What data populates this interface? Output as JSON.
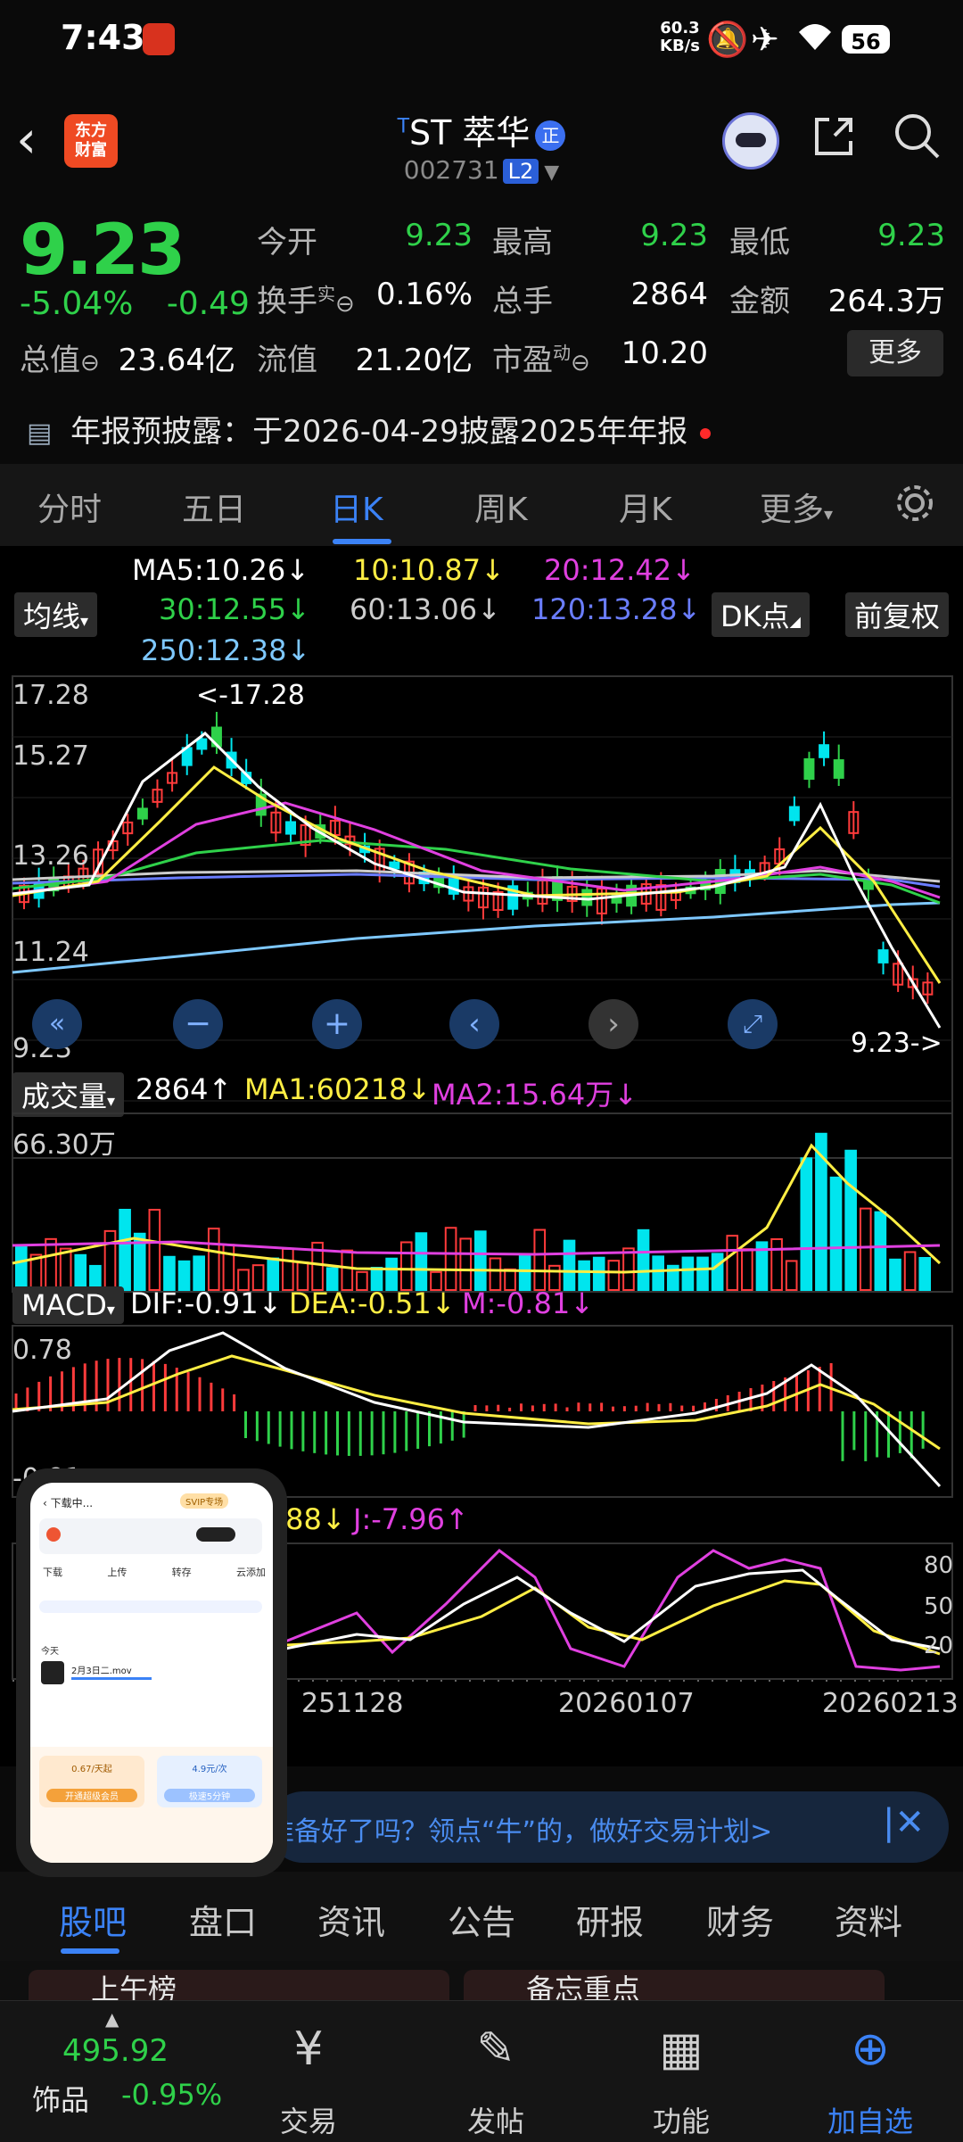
{
  "status": {
    "time": "7:43",
    "speed_top": "60.3",
    "speed_bottom": "KB/s",
    "battery": "56"
  },
  "header": {
    "logo_line1": "东方",
    "logo_line2": "财富",
    "superscript": "T",
    "name": "ST 萃华",
    "badge": "正",
    "code": "002731",
    "level": "L2"
  },
  "quote": {
    "price": "9.23",
    "pct": "-5.04%",
    "chg": "-0.49",
    "open_label": "今开",
    "open": "9.23",
    "high_label": "最高",
    "high": "9.23",
    "low_label": "最低",
    "low": "9.23",
    "turnover_label": "换手",
    "turnover_sup": "实",
    "turnover": "0.16%",
    "volume_label": "总手",
    "volume": "2864",
    "amount_label": "金额",
    "amount": "264.3万",
    "mcap_label": "总值",
    "mcap": "23.64亿",
    "float_label": "流值",
    "float": "21.20亿",
    "pe_label": "市盈",
    "pe_sup": "动",
    "pe": "10.20",
    "more": "更多"
  },
  "notice": {
    "text": "年报预披露：于2026-04-29披露2025年年报"
  },
  "periods": [
    "分时",
    "五日",
    "日K",
    "周K",
    "月K",
    "更多"
  ],
  "kline": {
    "ma_type": "均线",
    "ma5": "MA5:10.26↓",
    "ma10": "10:10.87↓",
    "ma20": "20:12.42↓",
    "ma30": "30:12.55↓",
    "ma60": "60:13.06↓",
    "ma120": "120:13.28↓",
    "ma250": "250:12.38↓",
    "dk": "DK点",
    "adjust": "前复权",
    "y1": "17.28",
    "y2": "15.27",
    "y3": "13.26",
    "y4": "11.24",
    "y5": "9.23",
    "max_label": "<-17.28",
    "last_label": "9.23->"
  },
  "volume": {
    "label": "成交量",
    "value": "2864↑",
    "ma1": "MA1:60218↓",
    "ma2": "MA2:15.64万↓",
    "ymax": "66.30万"
  },
  "macd": {
    "label": "MACD",
    "dif": "DIF:-0.91↓",
    "dea": "DEA:-0.51↓",
    "m": "M:-0.81↓",
    "ymax": "0.78",
    "ymin": "-0.91"
  },
  "kdj": {
    "partial": ".88↓",
    "j": "J:-7.96↑",
    "t80": "80",
    "t50": "50",
    "t20": "20",
    "dates": [
      "251128",
      "20260107",
      "20260213"
    ]
  },
  "banner": {
    "text": "准备好了吗？领点“牛”的，做好交易计划>"
  },
  "bottom_tabs": [
    "股吧",
    "盘口",
    "资讯",
    "公告",
    "研报",
    "财务",
    "资料"
  ],
  "feed": {
    "left": "上午榜",
    "right": "备忘重点"
  },
  "navbar": {
    "index_value": "495.92",
    "index_name": "饰品",
    "index_pct": "-0.95%",
    "items": [
      "交易",
      "发帖",
      "功能",
      "加自选"
    ]
  },
  "overlay": {
    "title": "下载中...",
    "vip": "SVIP专场",
    "tabs": [
      "下载",
      "上传",
      "转存",
      "云添加"
    ],
    "file": "2月3日二.mov",
    "today": "今天",
    "price1": "0.67/天起",
    "price2": "4.9元/次",
    "btn1": "开通超级会员",
    "btn2": "极速5分钟"
  },
  "colors": {
    "up": "#ff3b3b",
    "down": "#2fd14a",
    "accent": "#3b82f6",
    "cyan": "#00e5ee",
    "ma5": "#ffffff",
    "ma10": "#ffee44",
    "ma20": "#e040e0",
    "ma30": "#2fd14a",
    "ma60": "#cccccc",
    "ma120": "#6a7dff",
    "ma250": "#7ec8ff"
  }
}
